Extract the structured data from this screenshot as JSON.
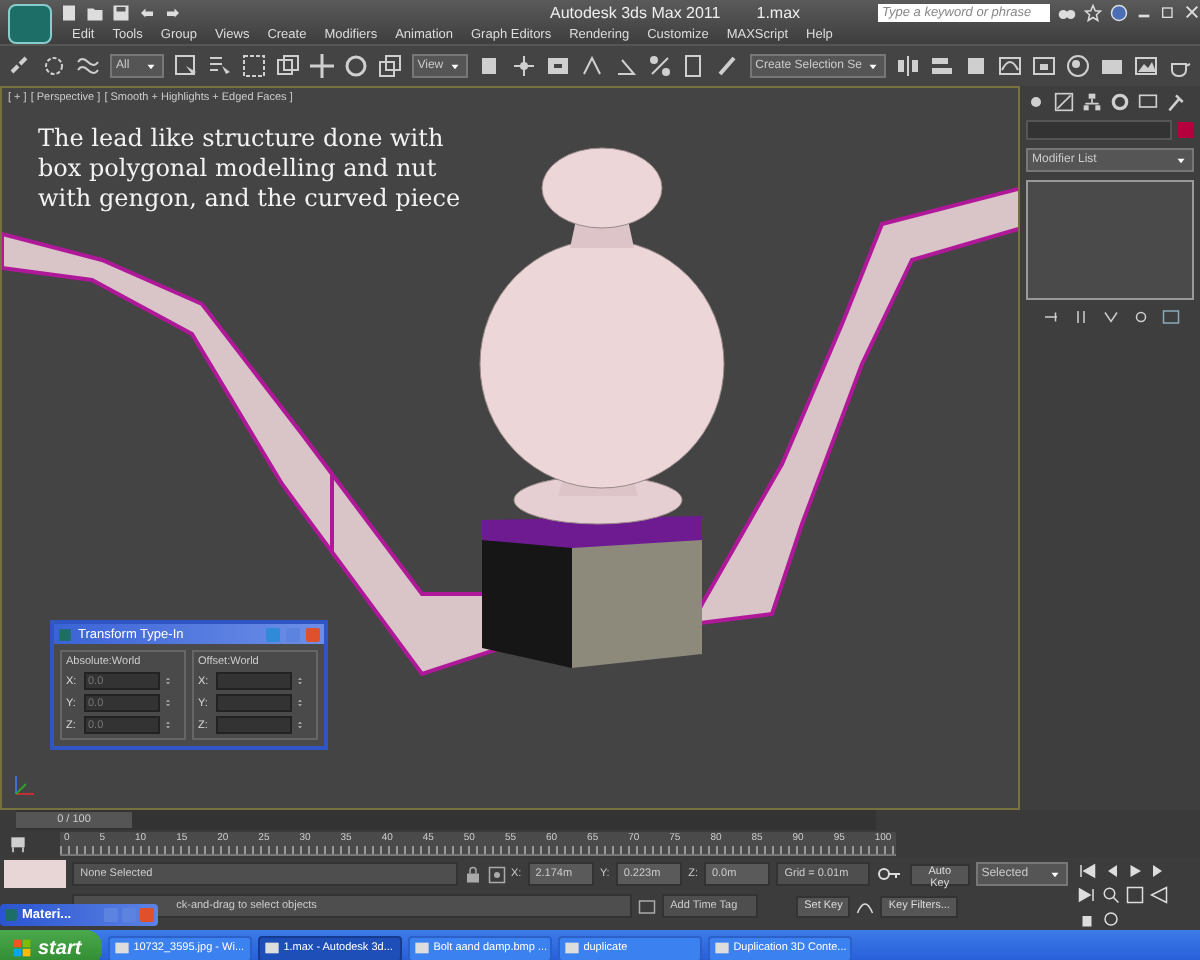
{
  "title_bar": {
    "app_title": "Autodesk 3ds Max  2011",
    "file_name": "1.max",
    "search_placeholder": "Type a keyword or phrase"
  },
  "menu": [
    "Edit",
    "Tools",
    "Group",
    "Views",
    "Create",
    "Modifiers",
    "Animation",
    "Graph Editors",
    "Rendering",
    "Customize",
    "MAXScript",
    "Help"
  ],
  "toolbar": {
    "selection_filter": "All",
    "reference_coord": "View",
    "selection_set": "Create Selection Se"
  },
  "viewport": {
    "labels": [
      "[ + ]",
      "[ Perspective ]",
      "[ Smooth + Highlights + Edged Faces ]"
    ],
    "annotation": "The lead like structure done with\nbox polygonal modelling and nut\nwith gengon, and the curved piece"
  },
  "transform_dialog": {
    "title": "Transform Type-In",
    "groups": [
      {
        "label": "Absolute:World",
        "fields": [
          {
            "axis": "X:",
            "value": "0.0"
          },
          {
            "axis": "Y:",
            "value": "0.0"
          },
          {
            "axis": "Z:",
            "value": "0.0"
          }
        ]
      },
      {
        "label": "Offset:World",
        "fields": [
          {
            "axis": "X:"
          },
          {
            "axis": "Y:"
          },
          {
            "axis": "Z:"
          }
        ]
      }
    ]
  },
  "command_panel": {
    "modifier_list": "Modifier List"
  },
  "time_slider": {
    "position": "0 / 100",
    "level": 0,
    "ticks": [
      "0",
      "5",
      "10",
      "15",
      "20",
      "25",
      "30",
      "35",
      "40",
      "45",
      "50",
      "55",
      "60",
      "65",
      "70",
      "75",
      "80",
      "85",
      "90",
      "95",
      "100"
    ]
  },
  "status": {
    "selection": "None Selected",
    "coords": [
      {
        "axis": "X:",
        "value": "2.174m"
      },
      {
        "axis": "Y:",
        "value": "0.223m"
      },
      {
        "axis": "Z:",
        "value": "0.0m"
      }
    ],
    "grid": "Grid = 0.01m",
    "prompt": "ck-and-drag to select objects",
    "add_time_tag": "Add Time Tag",
    "auto_key": "Auto Key",
    "key_mode": "Selected",
    "set_key": "Set Key",
    "key_filters": "Key Filters..."
  },
  "mini_window": {
    "title": "Materi..."
  },
  "taskbar": {
    "start": "start",
    "tasks": [
      {
        "label": "10732_3595.jpg - Wi...",
        "selected": false
      },
      {
        "label": "1.max - Autodesk 3d...",
        "selected": true
      },
      {
        "label": "Bolt aand damp.bmp ...",
        "selected": false
      },
      {
        "label": "duplicate",
        "selected": false
      },
      {
        "label": "Duplication 3D Conte...",
        "selected": false
      }
    ]
  }
}
